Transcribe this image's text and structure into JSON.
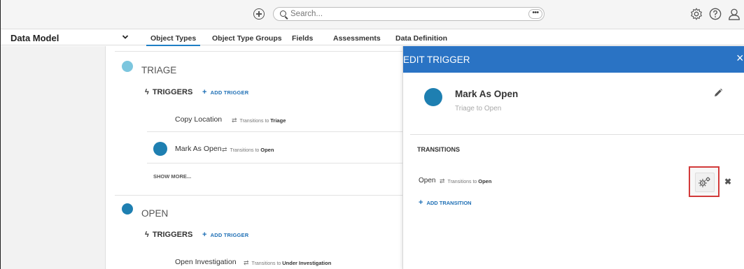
{
  "topbar": {
    "search_placeholder": "Search...",
    "more_label": "•••"
  },
  "navbar": {
    "module_title": "Data Model",
    "tabs": [
      {
        "label": "Object Types",
        "active": true
      },
      {
        "label": "Object Type Groups",
        "active": false
      },
      {
        "label": "Fields",
        "active": false
      },
      {
        "label": "Assessments",
        "active": false
      },
      {
        "label": "Data Definition",
        "active": false
      }
    ]
  },
  "workflow": {
    "states": [
      {
        "name": "TRIAGE",
        "color": "#7cc6de",
        "triggers_label": "TRIGGERS",
        "add_trigger_label": "ADD TRIGGER",
        "triggers": [
          {
            "name": "Copy Location",
            "transitions_prefix": "Transitions to",
            "target": "Triage"
          },
          {
            "name": "Mark As Open",
            "transitions_prefix": "Transitions to",
            "target": "Open"
          }
        ],
        "show_more_label": "SHOW MORE..."
      },
      {
        "name": "OPEN",
        "color": "#1e7fb1",
        "triggers_label": "TRIGGERS",
        "add_trigger_label": "ADD TRIGGER",
        "triggers": [
          {
            "name": "Open Investigation",
            "transitions_prefix": "Transitions to",
            "target": "Under Investigation"
          }
        ]
      }
    ]
  },
  "edit_panel": {
    "title": "EDIT TRIGGER",
    "close_glyph": "×",
    "trigger_name": "Mark As Open",
    "trigger_subtitle": "Triage to Open",
    "trigger_color": "#1e7fb1",
    "transitions_label": "TRANSITIONS",
    "transition": {
      "name": "Open",
      "transitions_prefix": "Transitions to",
      "target": "Open"
    },
    "remove_glyph": "✖",
    "add_transition_label": "ADD TRANSITION",
    "header_color": "#2a73c4",
    "highlight_color": "#d23a3a"
  },
  "icons": [
    "plus-circle-icon",
    "search-icon",
    "settings-icon",
    "help-icon",
    "user-icon",
    "chevron-down-icon",
    "bolt-icon",
    "transition-arrows-icon",
    "pencil-icon",
    "gears-icon",
    "close-icon"
  ]
}
